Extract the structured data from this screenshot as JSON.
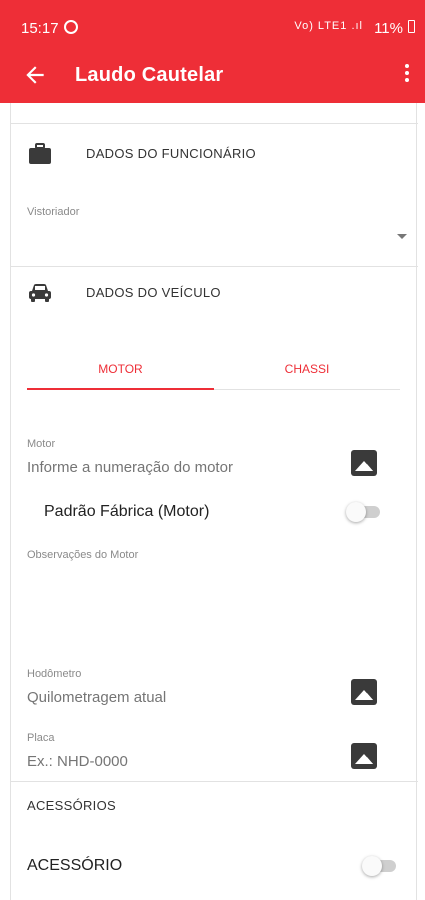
{
  "status_bar": {
    "time": "15:17",
    "indicators": "Vo) LTE1 .ıl",
    "battery": "11%"
  },
  "app_bar": {
    "title": "Laudo Cautelar",
    "back_icon": "arrow-left-icon",
    "menu_icon": "more-vertical-icon"
  },
  "funcionario_section": {
    "title": "DADOS DO FUNCIONÁRIO",
    "icon": "briefcase-icon",
    "vistoriador_label": "Vistoriador",
    "vistoriador_value": ""
  },
  "veiculo_section": {
    "title": "DADOS DO VEÍCULO",
    "icon": "car-icon",
    "tabs": [
      {
        "label": "MOTOR",
        "selected": true
      },
      {
        "label": "CHASSI",
        "selected": false
      }
    ],
    "motor_label": "Motor",
    "motor_placeholder": "Informe a numeração do motor",
    "padrao_fabrica_label": "Padrão Fábrica (Motor)",
    "padrao_fabrica_on": false,
    "observacoes_label": "Observações do Motor",
    "hodometro_label": "Hodômetro",
    "hodometro_placeholder": "Quilometragem atual",
    "placa_label": "Placa",
    "placa_placeholder": "Ex.: NHD-0000"
  },
  "acessorios_section": {
    "title": "ACESSÓRIOS",
    "item_label": "ACESSÓRIO",
    "item_on": false
  },
  "colors": {
    "primary": "#ee2e37",
    "divider": "#e2e2e2",
    "icon": "#3a3a3a"
  }
}
